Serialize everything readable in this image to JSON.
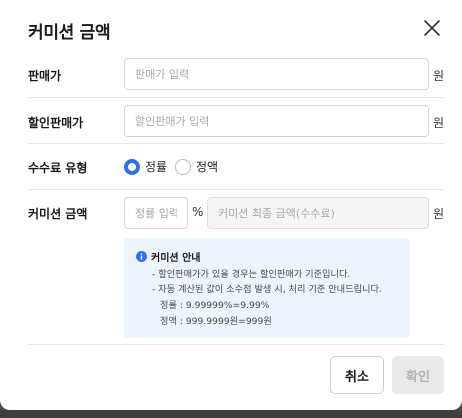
{
  "dialog": {
    "title": "커미션 금액"
  },
  "fields": {
    "sale_price": {
      "label": "판매가",
      "placeholder": "판매가 입력",
      "unit": "원"
    },
    "discount_price": {
      "label": "할인판매가",
      "placeholder": "할인판매가 입력",
      "unit": "원"
    },
    "fee_type": {
      "label": "수수료 유형",
      "options": [
        "정률",
        "정액"
      ],
      "selected": "정률"
    },
    "commission": {
      "label": "커미션 금액",
      "rate_placeholder": "정률 입력",
      "percent_unit": "%",
      "final_placeholder": "커미션 최종 금액(수수료)",
      "unit": "원"
    }
  },
  "notice": {
    "title": "커미션 안내",
    "lines": [
      "- 할인판매가가 있을 경우는 할인판매가 기준입니다.",
      "- 자동 계산된 값이 소수점 발생 시, 처리 기준 안내드립니다.",
      "정률 : 9.99999%=9.99%",
      "정액 : 999.9999원=999원"
    ]
  },
  "buttons": {
    "cancel": "취소",
    "confirm": "확인"
  },
  "colors": {
    "accent": "#2e6ff2",
    "notice_bg": "#eef4fd"
  }
}
